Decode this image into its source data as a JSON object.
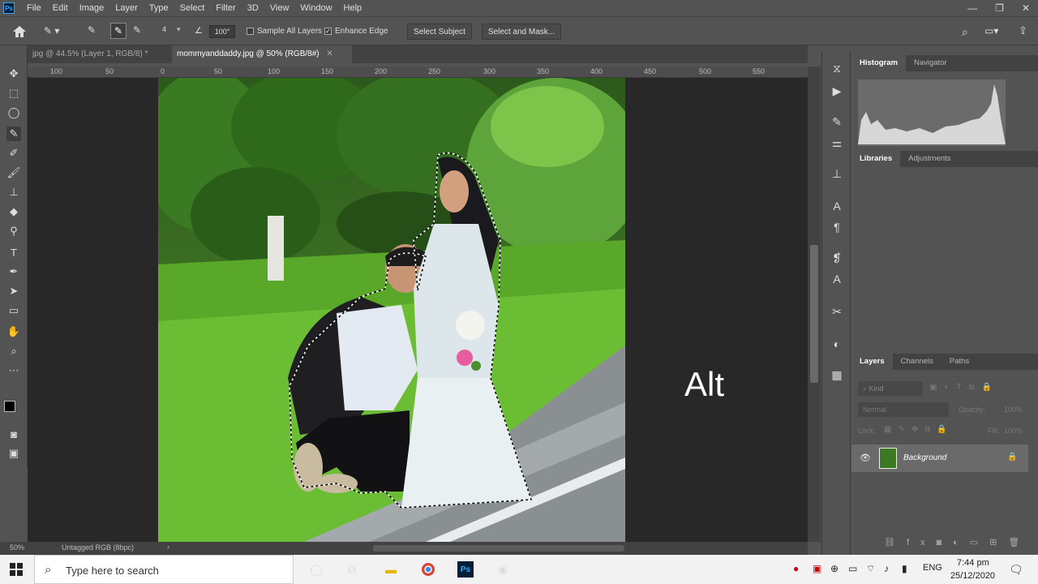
{
  "menubar": {
    "logo": "Ps",
    "items": [
      "File",
      "Edit",
      "Image",
      "Layer",
      "Type",
      "Select",
      "Filter",
      "3D",
      "View",
      "Window",
      "Help"
    ],
    "window_controls": [
      "—",
      "❐",
      "✕"
    ]
  },
  "options": {
    "brush_size": "4",
    "angle_value": "100°",
    "sample_all_layers": "Sample All Layers",
    "enhance_edge": "Enhance Edge",
    "select_subject": "Select Subject",
    "select_and_mask": "Select and Mask..."
  },
  "tabs": [
    {
      "label": "jpg @ 44.5% (Layer 1, RGB/8) *",
      "active": false
    },
    {
      "label": "mommyanddaddy.jpg @ 50% (RGB/8#)",
      "active": true
    }
  ],
  "ruler": {
    "labels": [
      "100",
      "50",
      "0",
      "50",
      "100",
      "150",
      "200",
      "250",
      "300",
      "350",
      "400",
      "450",
      "500",
      "550"
    ]
  },
  "canvas": {
    "overlay_text": "Alt"
  },
  "status": {
    "zoom": "50%",
    "profile": "Untagged RGB (8bpc)"
  },
  "panels": {
    "top_tabs": [
      "Histogram",
      "Navigator"
    ],
    "mid_tabs": [
      "Libraries",
      "Adjustments"
    ],
    "layers_tabs": [
      "Layers",
      "Channels",
      "Paths"
    ],
    "kind_placeholder": "Kind",
    "blend_mode": "Normal",
    "opacity_label": "Opacity:",
    "opacity_value": "100%",
    "lock_label": "Lock:",
    "fill_label": "Fill:",
    "fill_value": "100%",
    "layer_name": "Background"
  },
  "taskbar": {
    "search_placeholder": "Type here to search",
    "language": "ENG",
    "time": "7:44 pm",
    "date": "25/12/2020"
  },
  "colors": {
    "ps_bg": "#535353",
    "canvas_bg": "#282828",
    "accent": "#31a8ff"
  }
}
